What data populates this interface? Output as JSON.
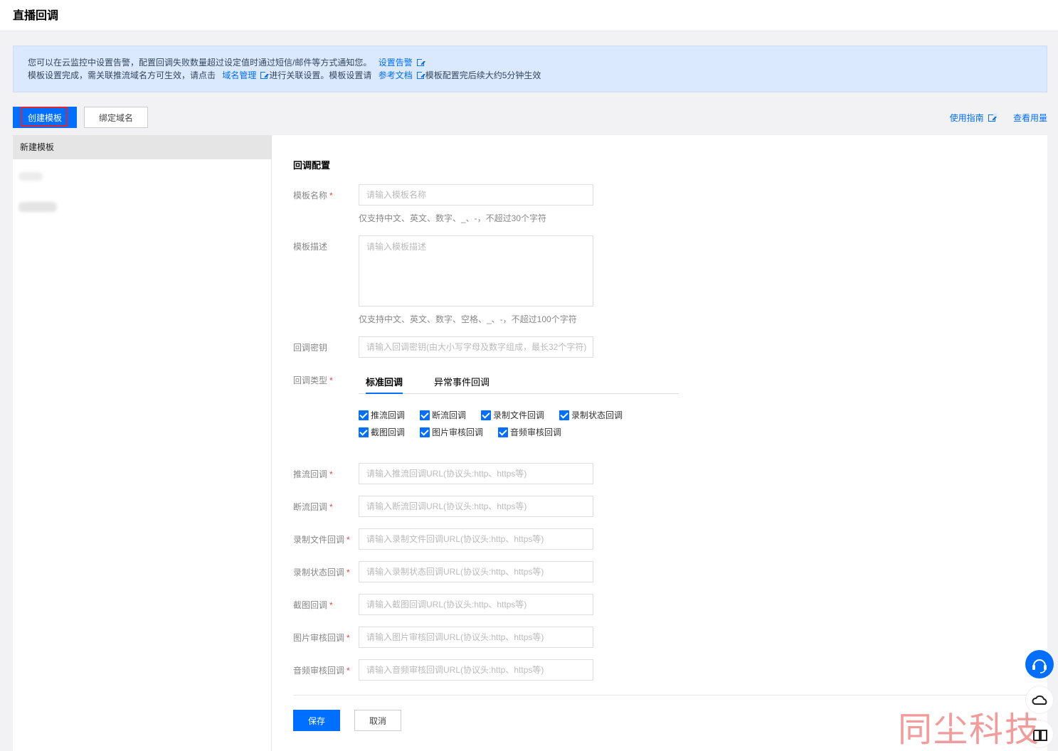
{
  "header": {
    "title": "直播回调"
  },
  "notice": {
    "line1_text": "您可以在云监控中设置告警，配置回调失败数量超过设定值时通过短信/邮件等方式通知您。",
    "line1_link": "设置告警",
    "line2_text1": "模板设置完成，需关联推流域名方可生效，请点击",
    "line2_link1": "域名管理",
    "line2_text2": "进行关联设置。模板设置请",
    "line2_link2": "参考文档",
    "line2_text3": "模板配置完后续大约5分钟生效"
  },
  "toolbar": {
    "create_label": "创建模板",
    "bind_label": "绑定域名",
    "guide_link": "使用指南",
    "usage_link": "查看用量"
  },
  "sidebar": {
    "selected_item": "新建模板"
  },
  "form": {
    "section_title": "回调配置",
    "name_label": "模板名称",
    "name_placeholder": "请输入模板名称",
    "name_hint": "仅支持中文、英文、数字、_、-，不超过30个字符",
    "desc_label": "模板描述",
    "desc_placeholder": "请输入模板描述",
    "desc_hint": "仅支持中文、英文、数字、空格、_、-，不超过100个字符",
    "key_label": "回调密钥",
    "key_placeholder": "请输入回调密钥(由大小写字母及数字组成，最长32个字符)",
    "type_label": "回调类型",
    "tabs": [
      "标准回调",
      "异常事件回调"
    ],
    "checkboxes": [
      "推流回调",
      "断流回调",
      "录制文件回调",
      "录制状态回调",
      "截图回调",
      "图片审核回调",
      "音频审核回调"
    ],
    "url_fields": [
      {
        "label": "推流回调",
        "placeholder": "请输入推流回调URL(协议头:http、https等)"
      },
      {
        "label": "断流回调",
        "placeholder": "请输入断流回调URL(协议头:http、https等)"
      },
      {
        "label": "录制文件回调",
        "placeholder": "请输入录制文件回调URL(协议头:http、https等)"
      },
      {
        "label": "录制状态回调",
        "placeholder": "请输入录制状态回调URL(协议头:http、https等)"
      },
      {
        "label": "截图回调",
        "placeholder": "请输入截图回调URL(协议头:http、https等)"
      },
      {
        "label": "图片审核回调",
        "placeholder": "请输入图片审核回调URL(协议头:http、https等)"
      },
      {
        "label": "音频审核回调",
        "placeholder": "请输入音频审核回调URL(协议头:http、https等)"
      }
    ],
    "save_label": "保存",
    "cancel_label": "取消",
    "required_mark": "*"
  },
  "watermark": "同尘科技"
}
